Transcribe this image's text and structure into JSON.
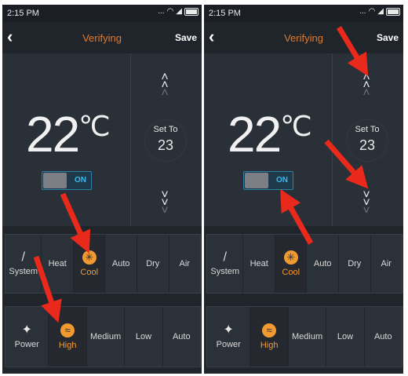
{
  "status_bar": {
    "time": "2:15 PM",
    "dots": "..."
  },
  "header": {
    "title": "Verifying",
    "save_label": "Save",
    "back_icon": "chevron-left-icon"
  },
  "thermostat": {
    "temperature": "22",
    "unit": "℃",
    "power_toggle": "ON",
    "set_to_label": "Set To",
    "set_to_value": "23"
  },
  "modes": {
    "items": [
      "System",
      "Heat",
      "Cool",
      "Auto",
      "Dry",
      "Air"
    ],
    "selected": "Cool"
  },
  "fan": {
    "items": [
      "Power",
      "High",
      "Medium",
      "Low",
      "Auto"
    ],
    "selected": "High"
  },
  "colors": {
    "accent": "#f29a32",
    "toggle_on": "#39b9ef",
    "title": "#e07a2c",
    "arrow": "#e8291c"
  }
}
